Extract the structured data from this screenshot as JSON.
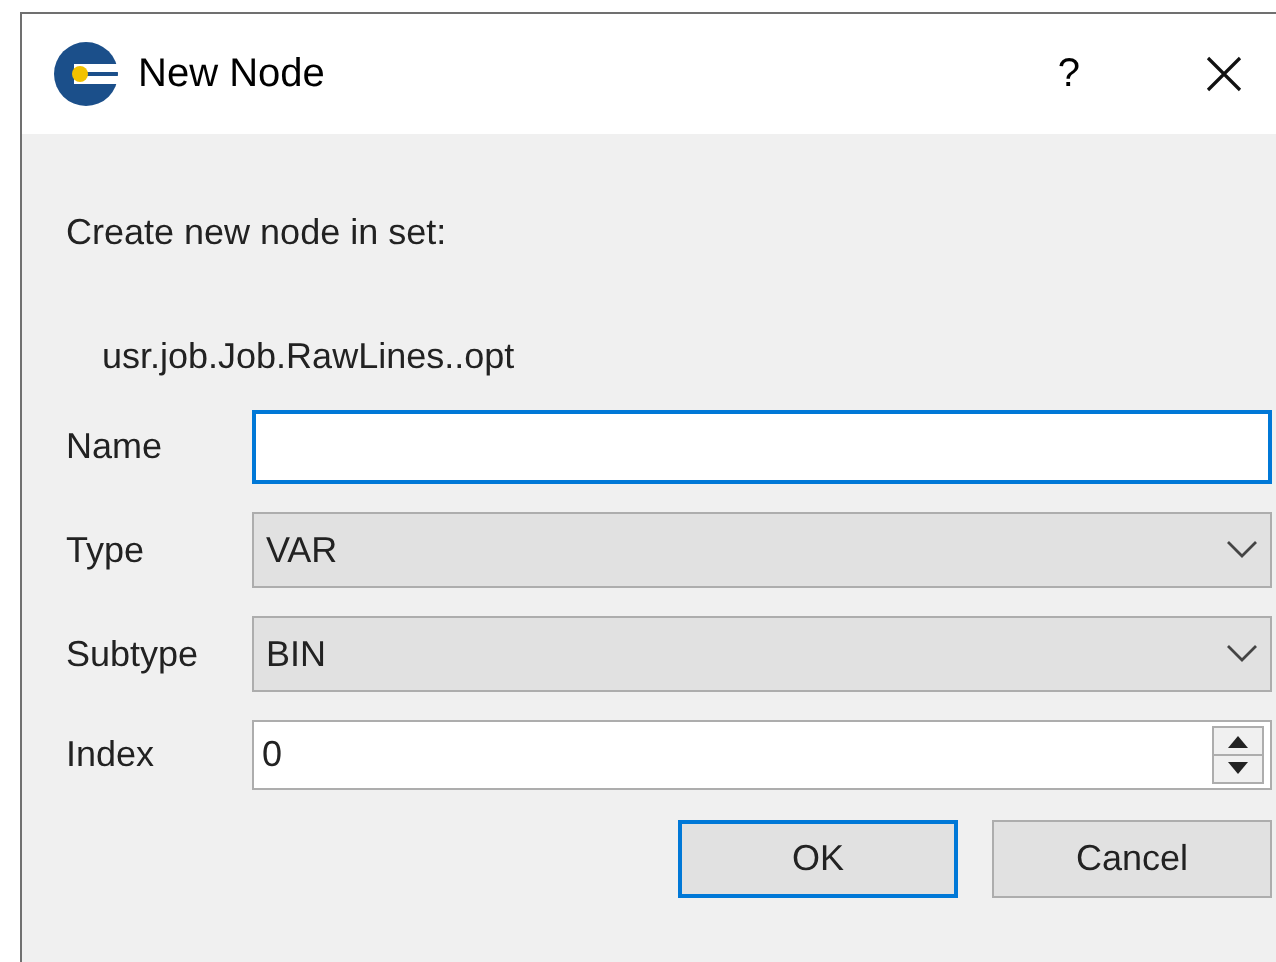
{
  "window": {
    "title": "New Node",
    "help": "?"
  },
  "prompt": "Create new node in set:",
  "set_path": "usr.job.Job.RawLines..opt",
  "fields": [
    {
      "kind": "text",
      "label": "Name",
      "focused": true
    },
    {
      "kind": "combo",
      "label": "Type",
      "value": "VAR",
      "focused": false
    },
    {
      "kind": "combo",
      "label": "Subtype",
      "value": "BIN",
      "focused": false
    },
    {
      "kind": "spin",
      "label": "Index",
      "value": "0",
      "focused": false
    }
  ],
  "buttons": [
    {
      "label": "OK",
      "default": true
    },
    {
      "label": "Cancel",
      "default": false
    }
  ]
}
